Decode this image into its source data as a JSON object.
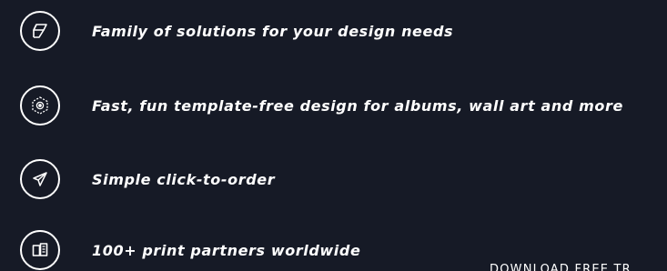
{
  "features": [
    {
      "icon": "cube-perspective-icon",
      "text": "Family of solutions for your design needs"
    },
    {
      "icon": "hexagon-target-icon",
      "text": "Fast, fun template-free design for albums, wall art and more"
    },
    {
      "icon": "paper-plane-icon",
      "text": "Simple click-to-order"
    },
    {
      "icon": "print-pages-icon",
      "text": "100+ print partners worldwide"
    }
  ],
  "download_label": "DOWNLOAD FREE TR",
  "colors": {
    "background": "#161a26",
    "text": "#ffffff"
  }
}
